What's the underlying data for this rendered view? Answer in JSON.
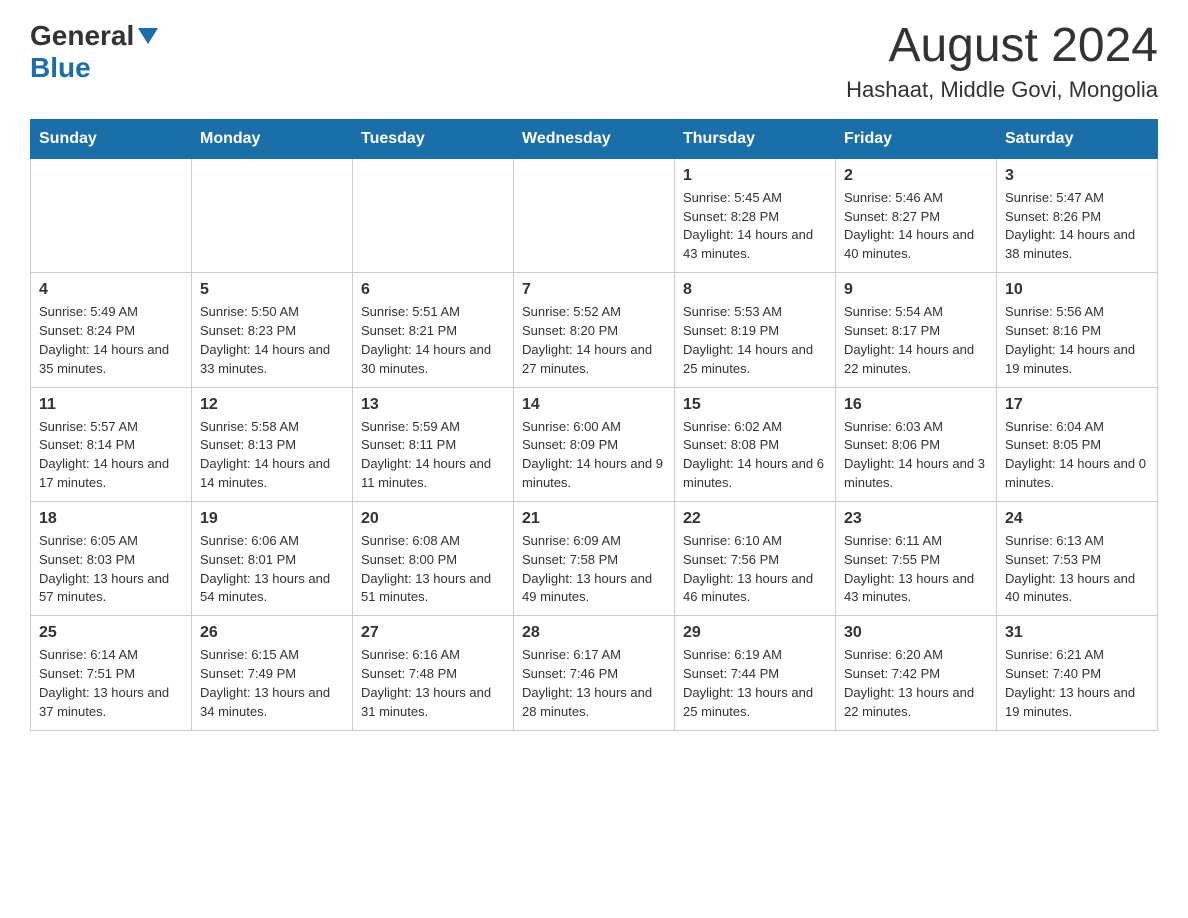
{
  "header": {
    "logo_general": "General",
    "logo_blue": "Blue",
    "title": "August 2024",
    "subtitle": "Hashaat, Middle Govi, Mongolia"
  },
  "weekdays": [
    "Sunday",
    "Monday",
    "Tuesday",
    "Wednesday",
    "Thursday",
    "Friday",
    "Saturday"
  ],
  "weeks": [
    [
      {
        "day": "",
        "info": ""
      },
      {
        "day": "",
        "info": ""
      },
      {
        "day": "",
        "info": ""
      },
      {
        "day": "",
        "info": ""
      },
      {
        "day": "1",
        "info": "Sunrise: 5:45 AM\nSunset: 8:28 PM\nDaylight: 14 hours and 43 minutes."
      },
      {
        "day": "2",
        "info": "Sunrise: 5:46 AM\nSunset: 8:27 PM\nDaylight: 14 hours and 40 minutes."
      },
      {
        "day": "3",
        "info": "Sunrise: 5:47 AM\nSunset: 8:26 PM\nDaylight: 14 hours and 38 minutes."
      }
    ],
    [
      {
        "day": "4",
        "info": "Sunrise: 5:49 AM\nSunset: 8:24 PM\nDaylight: 14 hours and 35 minutes."
      },
      {
        "day": "5",
        "info": "Sunrise: 5:50 AM\nSunset: 8:23 PM\nDaylight: 14 hours and 33 minutes."
      },
      {
        "day": "6",
        "info": "Sunrise: 5:51 AM\nSunset: 8:21 PM\nDaylight: 14 hours and 30 minutes."
      },
      {
        "day": "7",
        "info": "Sunrise: 5:52 AM\nSunset: 8:20 PM\nDaylight: 14 hours and 27 minutes."
      },
      {
        "day": "8",
        "info": "Sunrise: 5:53 AM\nSunset: 8:19 PM\nDaylight: 14 hours and 25 minutes."
      },
      {
        "day": "9",
        "info": "Sunrise: 5:54 AM\nSunset: 8:17 PM\nDaylight: 14 hours and 22 minutes."
      },
      {
        "day": "10",
        "info": "Sunrise: 5:56 AM\nSunset: 8:16 PM\nDaylight: 14 hours and 19 minutes."
      }
    ],
    [
      {
        "day": "11",
        "info": "Sunrise: 5:57 AM\nSunset: 8:14 PM\nDaylight: 14 hours and 17 minutes."
      },
      {
        "day": "12",
        "info": "Sunrise: 5:58 AM\nSunset: 8:13 PM\nDaylight: 14 hours and 14 minutes."
      },
      {
        "day": "13",
        "info": "Sunrise: 5:59 AM\nSunset: 8:11 PM\nDaylight: 14 hours and 11 minutes."
      },
      {
        "day": "14",
        "info": "Sunrise: 6:00 AM\nSunset: 8:09 PM\nDaylight: 14 hours and 9 minutes."
      },
      {
        "day": "15",
        "info": "Sunrise: 6:02 AM\nSunset: 8:08 PM\nDaylight: 14 hours and 6 minutes."
      },
      {
        "day": "16",
        "info": "Sunrise: 6:03 AM\nSunset: 8:06 PM\nDaylight: 14 hours and 3 minutes."
      },
      {
        "day": "17",
        "info": "Sunrise: 6:04 AM\nSunset: 8:05 PM\nDaylight: 14 hours and 0 minutes."
      }
    ],
    [
      {
        "day": "18",
        "info": "Sunrise: 6:05 AM\nSunset: 8:03 PM\nDaylight: 13 hours and 57 minutes."
      },
      {
        "day": "19",
        "info": "Sunrise: 6:06 AM\nSunset: 8:01 PM\nDaylight: 13 hours and 54 minutes."
      },
      {
        "day": "20",
        "info": "Sunrise: 6:08 AM\nSunset: 8:00 PM\nDaylight: 13 hours and 51 minutes."
      },
      {
        "day": "21",
        "info": "Sunrise: 6:09 AM\nSunset: 7:58 PM\nDaylight: 13 hours and 49 minutes."
      },
      {
        "day": "22",
        "info": "Sunrise: 6:10 AM\nSunset: 7:56 PM\nDaylight: 13 hours and 46 minutes."
      },
      {
        "day": "23",
        "info": "Sunrise: 6:11 AM\nSunset: 7:55 PM\nDaylight: 13 hours and 43 minutes."
      },
      {
        "day": "24",
        "info": "Sunrise: 6:13 AM\nSunset: 7:53 PM\nDaylight: 13 hours and 40 minutes."
      }
    ],
    [
      {
        "day": "25",
        "info": "Sunrise: 6:14 AM\nSunset: 7:51 PM\nDaylight: 13 hours and 37 minutes."
      },
      {
        "day": "26",
        "info": "Sunrise: 6:15 AM\nSunset: 7:49 PM\nDaylight: 13 hours and 34 minutes."
      },
      {
        "day": "27",
        "info": "Sunrise: 6:16 AM\nSunset: 7:48 PM\nDaylight: 13 hours and 31 minutes."
      },
      {
        "day": "28",
        "info": "Sunrise: 6:17 AM\nSunset: 7:46 PM\nDaylight: 13 hours and 28 minutes."
      },
      {
        "day": "29",
        "info": "Sunrise: 6:19 AM\nSunset: 7:44 PM\nDaylight: 13 hours and 25 minutes."
      },
      {
        "day": "30",
        "info": "Sunrise: 6:20 AM\nSunset: 7:42 PM\nDaylight: 13 hours and 22 minutes."
      },
      {
        "day": "31",
        "info": "Sunrise: 6:21 AM\nSunset: 7:40 PM\nDaylight: 13 hours and 19 minutes."
      }
    ]
  ]
}
